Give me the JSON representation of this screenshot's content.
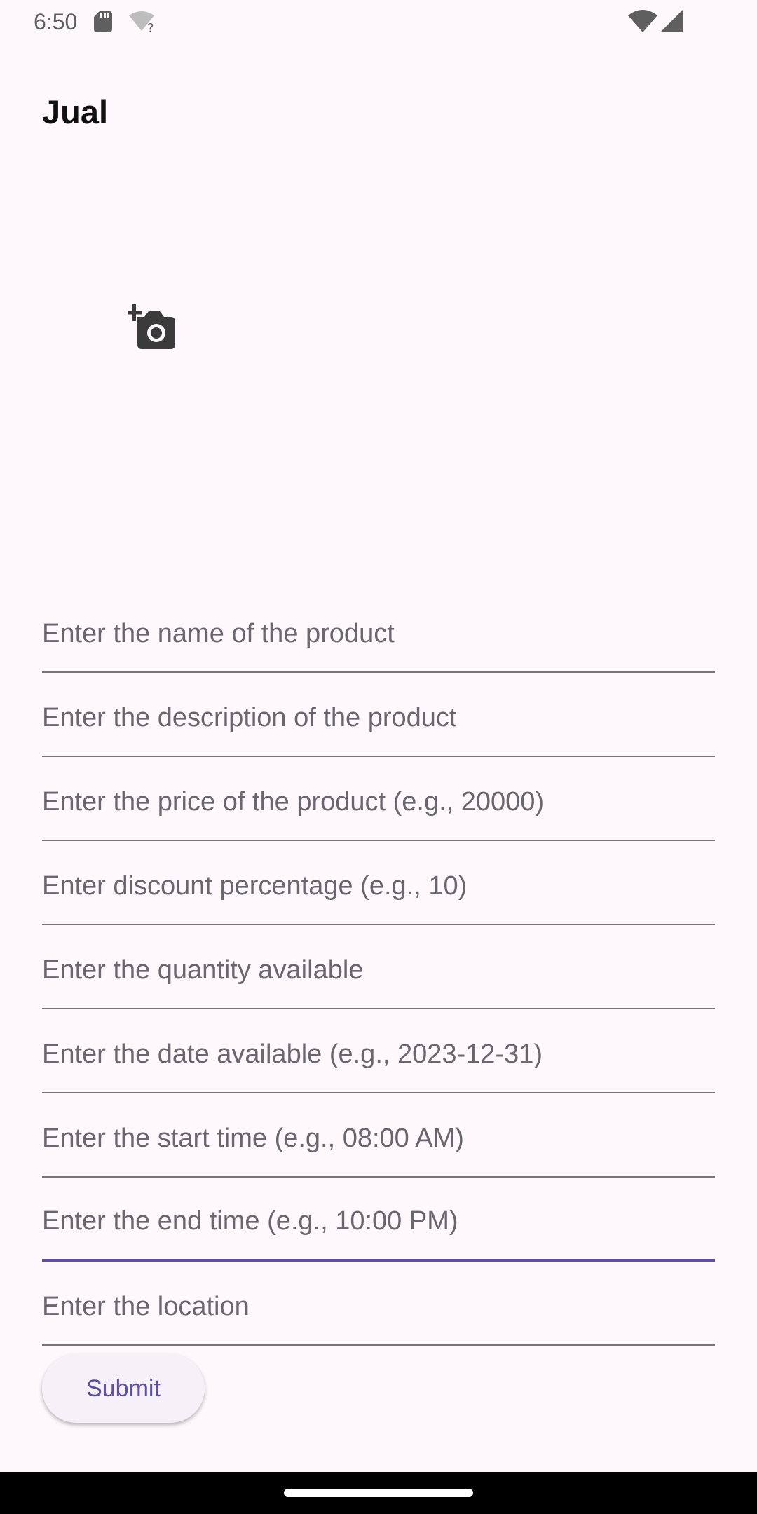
{
  "status_bar": {
    "time": "6:50",
    "icons": [
      "sd-card-icon",
      "wifi-unknown-icon",
      "wifi-signal-icon",
      "cell-signal-icon"
    ]
  },
  "app": {
    "title": "Jual"
  },
  "photo_picker": {
    "icon": "add-a-photo-icon"
  },
  "form": {
    "fields": [
      {
        "placeholder": "Enter the name of the product",
        "value": ""
      },
      {
        "placeholder": "Enter the description of the product",
        "value": ""
      },
      {
        "placeholder": "Enter the price of the product (e.g., 20000)",
        "value": ""
      },
      {
        "placeholder": "Enter discount percentage (e.g., 10)",
        "value": ""
      },
      {
        "placeholder": "Enter the quantity available",
        "value": ""
      },
      {
        "placeholder": "Enter the date available (e.g., 2023-12-31)",
        "value": ""
      },
      {
        "placeholder": "Enter the start time (e.g., 08:00 AM)",
        "value": ""
      },
      {
        "placeholder": "Enter the end time (e.g., 10:00 PM)",
        "value": "",
        "focused": true
      },
      {
        "placeholder": "Enter the location",
        "value": ""
      }
    ],
    "submit_label": "Submit"
  },
  "colors": {
    "background": "#fef7fb",
    "accent": "#5e4fa2",
    "divider": "#7b7480",
    "placeholder": "#6a6670"
  }
}
